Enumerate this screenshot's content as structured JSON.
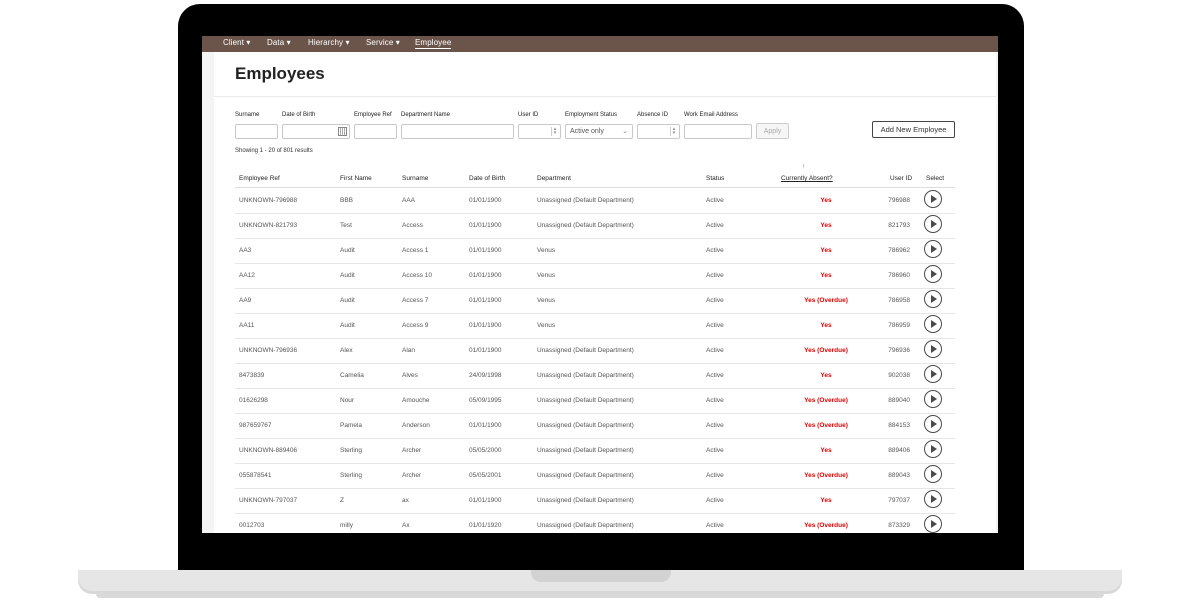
{
  "nav": {
    "items": [
      "Client ▾",
      "Data ▾",
      "Hierarchy ▾",
      "Service ▾",
      "Employee"
    ],
    "active": "Employee"
  },
  "page": {
    "title": "Employees"
  },
  "filters": {
    "surname_label": "Surname",
    "dob_label": "Date of Birth",
    "employee_ref_label": "Employee Ref",
    "department_label": "Department Name",
    "user_id_label": "User ID",
    "employment_status_label": "Employment Status",
    "employment_status_value": "Active only",
    "absence_id_label": "Absence ID",
    "work_email_label": "Work Email Address",
    "apply_label": "Apply",
    "add_new_label": "Add New Employee"
  },
  "results": {
    "showing": "Showing 1 - 20 of 801 results"
  },
  "table": {
    "headers": [
      "Employee Ref",
      "First Name",
      "Surname",
      "Date of Birth",
      "Department",
      "Status",
      "Currently Absent?",
      "User ID",
      "Select"
    ],
    "sort_indicator": "↑",
    "rows": [
      {
        "ref": "UNKNOWN-796988",
        "first": "BBB",
        "surname": "AAA",
        "dob": "01/01/1900",
        "dept": "Unassigned (Default Department)",
        "status": "Active",
        "absent": "Yes",
        "uid": "796988"
      },
      {
        "ref": "UNKNOWN-821793",
        "first": "Test",
        "surname": "Access",
        "dob": "01/01/1900",
        "dept": "Unassigned (Default Department)",
        "status": "Active",
        "absent": "Yes",
        "uid": "821793"
      },
      {
        "ref": "AA3",
        "first": "Audit",
        "surname": "Access 1",
        "dob": "01/01/1900",
        "dept": "Venus",
        "status": "Active",
        "absent": "Yes",
        "uid": "786962"
      },
      {
        "ref": "AA12",
        "first": "Audit",
        "surname": "Access 10",
        "dob": "01/01/1900",
        "dept": "Venus",
        "status": "Active",
        "absent": "Yes",
        "uid": "786960"
      },
      {
        "ref": "AA9",
        "first": "Audit",
        "surname": "Access 7",
        "dob": "01/01/1900",
        "dept": "Venus",
        "status": "Active",
        "absent": "Yes (Overdue)",
        "uid": "786958"
      },
      {
        "ref": "AA11",
        "first": "Audit",
        "surname": "Access 9",
        "dob": "01/01/1900",
        "dept": "Venus",
        "status": "Active",
        "absent": "Yes",
        "uid": "786959"
      },
      {
        "ref": "UNKNOWN-796936",
        "first": "Alex",
        "surname": "Alan",
        "dob": "01/01/1900",
        "dept": "Unassigned (Default Department)",
        "status": "Active",
        "absent": "Yes (Overdue)",
        "uid": "796936"
      },
      {
        "ref": "8473839",
        "first": "Camelia",
        "surname": "Alves",
        "dob": "24/09/1998",
        "dept": "Unassigned (Default Department)",
        "status": "Active",
        "absent": "Yes",
        "uid": "902038"
      },
      {
        "ref": "01626298",
        "first": "Nour",
        "surname": "Amouche",
        "dob": "05/09/1995",
        "dept": "Unassigned (Default Department)",
        "status": "Active",
        "absent": "Yes (Overdue)",
        "uid": "889040"
      },
      {
        "ref": "987659767",
        "first": "Pamela",
        "surname": "Anderson",
        "dob": "01/01/1900",
        "dept": "Unassigned (Default Department)",
        "status": "Active",
        "absent": "Yes (Overdue)",
        "uid": "884153"
      },
      {
        "ref": "UNKNOWN-889406",
        "first": "Sterling",
        "surname": "Archer",
        "dob": "05/05/2000",
        "dept": "Unassigned (Default Department)",
        "status": "Active",
        "absent": "Yes",
        "uid": "889406"
      },
      {
        "ref": "055878541",
        "first": "Sterling",
        "surname": "Archer",
        "dob": "05/05/2001",
        "dept": "Unassigned (Default Department)",
        "status": "Active",
        "absent": "Yes (Overdue)",
        "uid": "889043"
      },
      {
        "ref": "UNKNOWN-797037",
        "first": "Z",
        "surname": "ax",
        "dob": "01/01/1900",
        "dept": "Unassigned (Default Department)",
        "status": "Active",
        "absent": "Yes",
        "uid": "797037"
      },
      {
        "ref": "0012703",
        "first": "milly",
        "surname": "Ax",
        "dob": "01/01/1920",
        "dept": "Unassigned (Default Department)",
        "status": "Active",
        "absent": "Yes (Overdue)",
        "uid": "873329"
      }
    ]
  },
  "colors": {
    "nav_bg": "#6b554b",
    "absent_text": "#e00000"
  }
}
